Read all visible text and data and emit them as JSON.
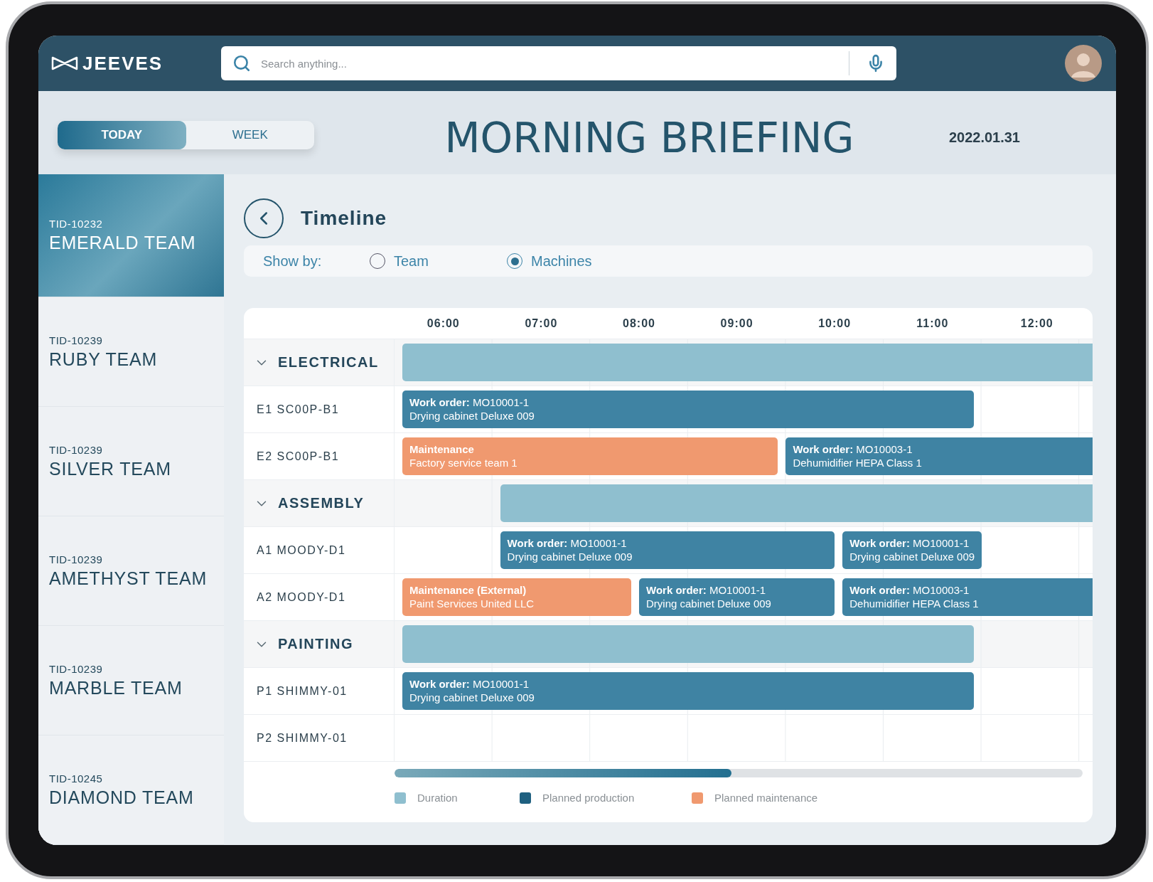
{
  "header": {
    "logo": "JEEVES",
    "search": {
      "placeholder": "Search anything..."
    }
  },
  "view_toggle": [
    {
      "label": "TODAY",
      "selected": true
    },
    {
      "label": "WEEK",
      "selected": false
    }
  ],
  "title": "MORNING BRIEFING",
  "date": "2022.01.31",
  "teams": [
    {
      "id": "TID-10232",
      "name": "EMERALD TEAM",
      "selected": true
    },
    {
      "id": "TID-10239",
      "name": "RUBY TEAM",
      "selected": false
    },
    {
      "id": "TID-10239",
      "name": "SILVER TEAM",
      "selected": false
    },
    {
      "id": "TID-10239",
      "name": "AMETHYST TEAM",
      "selected": false
    },
    {
      "id": "TID-10239",
      "name": "MARBLE TEAM",
      "selected": false
    },
    {
      "id": "TID-10245",
      "name": "DIAMOND TEAM",
      "selected": false
    }
  ],
  "timeline": {
    "title": "Timeline",
    "show_by": {
      "label": "Show by:",
      "options": [
        {
          "label": "Team",
          "selected": false
        },
        {
          "label": "Machines",
          "selected": true
        }
      ]
    },
    "hours": [
      "06:00",
      "07:00",
      "08:00",
      "09:00",
      "10:00",
      "11:00",
      "12:00"
    ],
    "groups": [
      {
        "label": "ELECTRICAL",
        "expanded": true,
        "machines": [
          {
            "label": "E1 SC00P-B1",
            "bars": [
              {
                "kind": "production",
                "label": "Work order:",
                "ref": "MO10001-1",
                "detail": "Drying cabinet Deluxe 009"
              }
            ]
          },
          {
            "label": "E2 SC00P-B1",
            "bars": [
              {
                "kind": "maintenance",
                "label": "Maintenance",
                "detail": "Factory service team 1"
              },
              {
                "kind": "production",
                "label": "Work order:",
                "ref": "MO10003-1",
                "detail": "Dehumidifier HEPA Class 1"
              }
            ]
          }
        ]
      },
      {
        "label": "ASSEMBLY",
        "expanded": true,
        "machines": [
          {
            "label": "A1 MOODY-D1",
            "bars": [
              {
                "kind": "production",
                "label": "Work order:",
                "ref": "MO10001-1",
                "detail": "Drying cabinet Deluxe 009"
              },
              {
                "kind": "production",
                "label": "Work order:",
                "ref": "MO10001-1",
                "detail": "Drying cabinet Deluxe 009"
              }
            ]
          },
          {
            "label": "A2 MOODY-D1",
            "bars": [
              {
                "kind": "maintenance",
                "label": "Maintenance (External)",
                "detail": "Paint Services United LLC"
              },
              {
                "kind": "production",
                "label": "Work order:",
                "ref": "MO10001-1",
                "detail": "Drying cabinet Deluxe 009"
              },
              {
                "kind": "production",
                "label": "Work order:",
                "ref": "MO10003-1",
                "detail": "Dehumidifier HEPA Class 1"
              }
            ]
          }
        ]
      },
      {
        "label": "PAINTING",
        "expanded": true,
        "machines": [
          {
            "label": "P1 SHIMMY-01",
            "bars": [
              {
                "kind": "production",
                "label": "Work order:",
                "ref": "MO10001-1",
                "detail": "Drying cabinet Deluxe 009"
              }
            ]
          },
          {
            "label": "P2 SHIMMY-01"
          }
        ]
      }
    ],
    "legend": [
      {
        "label": "Duration",
        "color": "#8fbfcf"
      },
      {
        "label": "Planned production",
        "color": "#1f6080"
      },
      {
        "label": "Planned maintenance",
        "color": "#f0996f"
      }
    ]
  }
}
